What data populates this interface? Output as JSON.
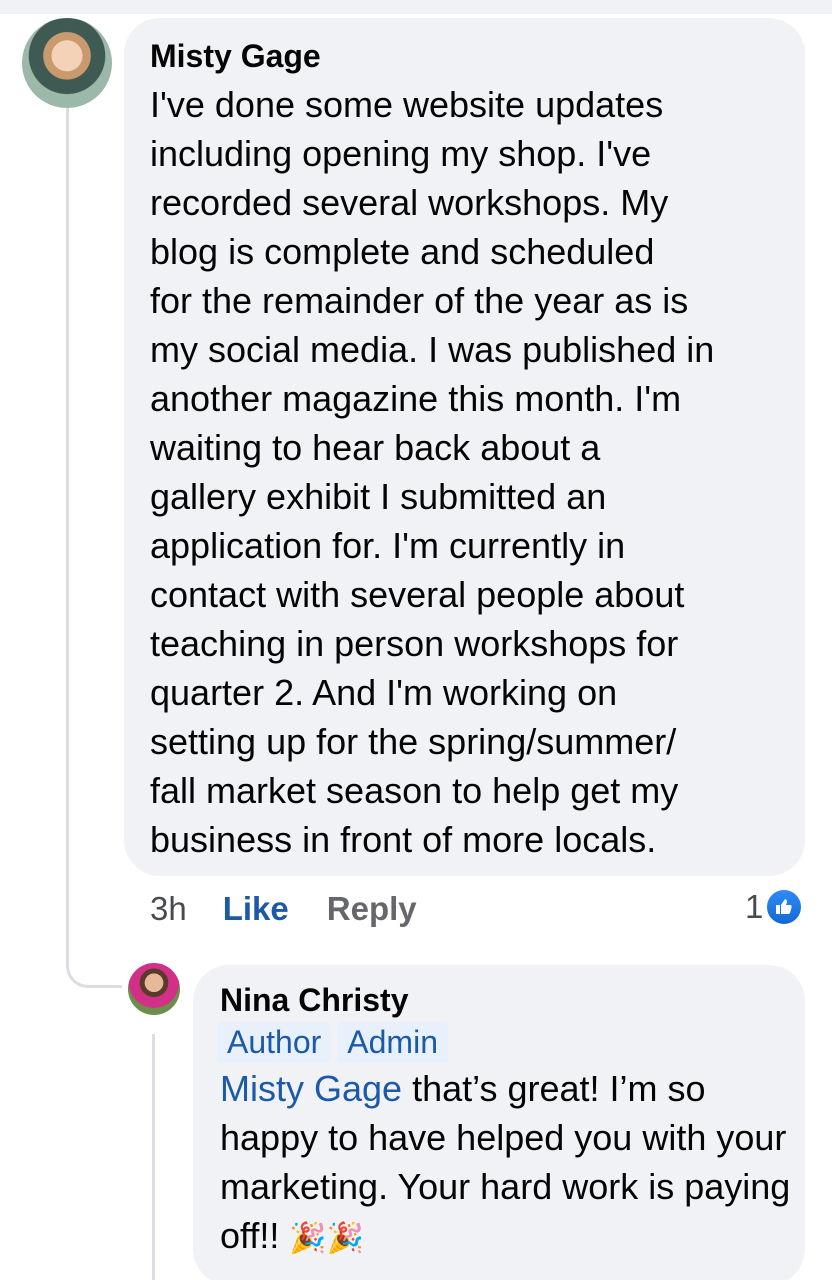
{
  "comment": {
    "author": "Misty Gage",
    "text": "I've done some website updates\nincluding opening my shop. I've\nrecorded several workshops. My\nblog is complete and scheduled\nfor the remainder of the year as is\nmy social media. I was published in\nanother magazine this month. I'm\nwaiting to hear back about a\ngallery exhibit I submitted an\napplication for. I'm currently in\ncontact with several people about\nteaching in person workshops for\nquarter 2. And I'm working on\nsetting up for the spring/summer/\nfall market season to help get my\nbusiness in front of more locals.",
    "time": "3h",
    "like_label": "Like",
    "reply_label": "Reply",
    "reaction_count": "1",
    "reaction_icon": "like-thumb-icon"
  },
  "reply": {
    "author": "Nina Christy",
    "badges": [
      "Author",
      "Admin"
    ],
    "mention": "Misty Gage",
    "text": " that’s great! I’m so happy to have helped you with your marketing. Your hard work is paying off!! ",
    "emoji": "🎉🎉"
  },
  "colors": {
    "bubble": "#f0f2f5",
    "link_blue": "#1c59a8",
    "badge_bg": "#e7f0fb"
  }
}
